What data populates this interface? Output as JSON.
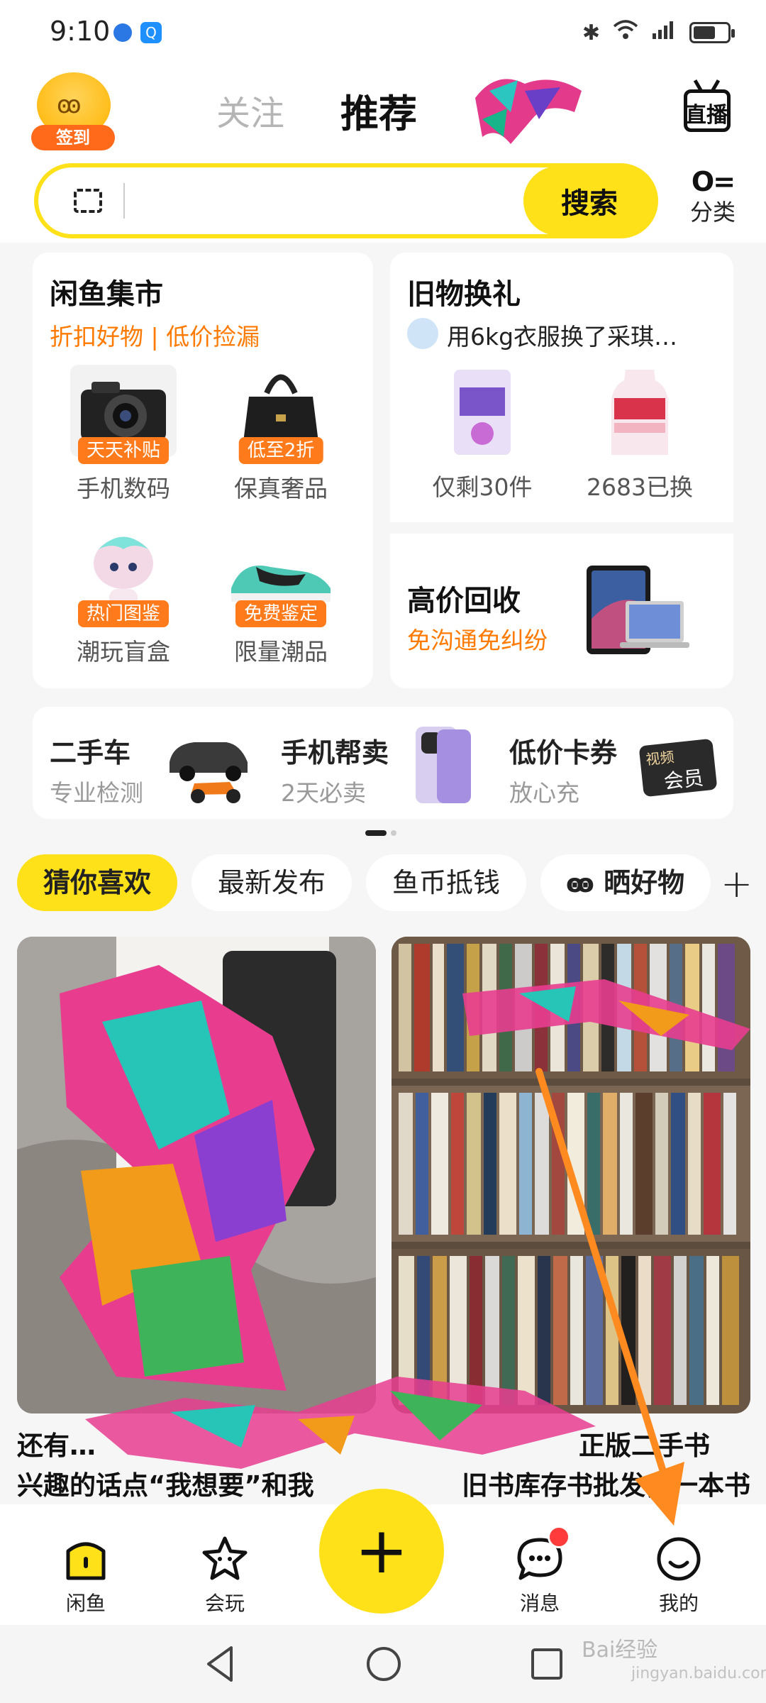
{
  "status_bar": {
    "time": "9:10"
  },
  "header": {
    "sign_label": "签到",
    "tabs": [
      {
        "label": "关注"
      },
      {
        "label": "推荐"
      }
    ],
    "live_label": "直播"
  },
  "search": {
    "button_label": "搜索",
    "category_label": "分类"
  },
  "market_card": {
    "title": "闲鱼集市",
    "subtitle": "折扣好物 | 低价捡漏",
    "items": [
      {
        "label": "手机数码",
        "tag": "天天补贴"
      },
      {
        "label": "保真奢品",
        "tag": "低至2折"
      },
      {
        "label": "潮玩盲盒",
        "tag": "热门图鉴"
      },
      {
        "label": "限量潮品",
        "tag": "免费鉴定"
      }
    ]
  },
  "exchange_card": {
    "title": "旧物换礼",
    "ticker": "用6kg衣服换了采琪…",
    "items": [
      {
        "label": "仅剩30件"
      },
      {
        "label": "2683已换"
      }
    ]
  },
  "recycle_card": {
    "title": "高价回收",
    "subtitle": "免沟通免纠纷"
  },
  "services": [
    {
      "title": "二手车",
      "sub": "专业检测"
    },
    {
      "title": "手机帮卖",
      "sub": "2天必卖"
    },
    {
      "title": "低价卡券",
      "sub": "放心充"
    }
  ],
  "video_member": {
    "line1": "视频",
    "line2": "会员"
  },
  "feed_tabs": [
    {
      "label": "猜你喜欢"
    },
    {
      "label": "最新发布"
    },
    {
      "label": "鱼币抵钱"
    },
    {
      "label": "晒好物"
    }
  ],
  "feed": [
    {
      "caption_line1": "还有…",
      "caption_line2": "兴趣的话点“我想要”和我"
    },
    {
      "caption_line1": "正版二手书",
      "caption_line2": "旧书库存书批发，一本书"
    }
  ],
  "bottom_nav": [
    {
      "label": "闲鱼"
    },
    {
      "label": "会玩"
    },
    {
      "label": "消息"
    },
    {
      "label": "我的"
    }
  ],
  "publish_label": "+",
  "watermark": {
    "brand": "Bai经验",
    "url": "jingyan.baidu.com"
  },
  "colors": {
    "accent": "#ffe11a",
    "orange": "#ff7a00",
    "arrow": "#ff8a1f"
  }
}
